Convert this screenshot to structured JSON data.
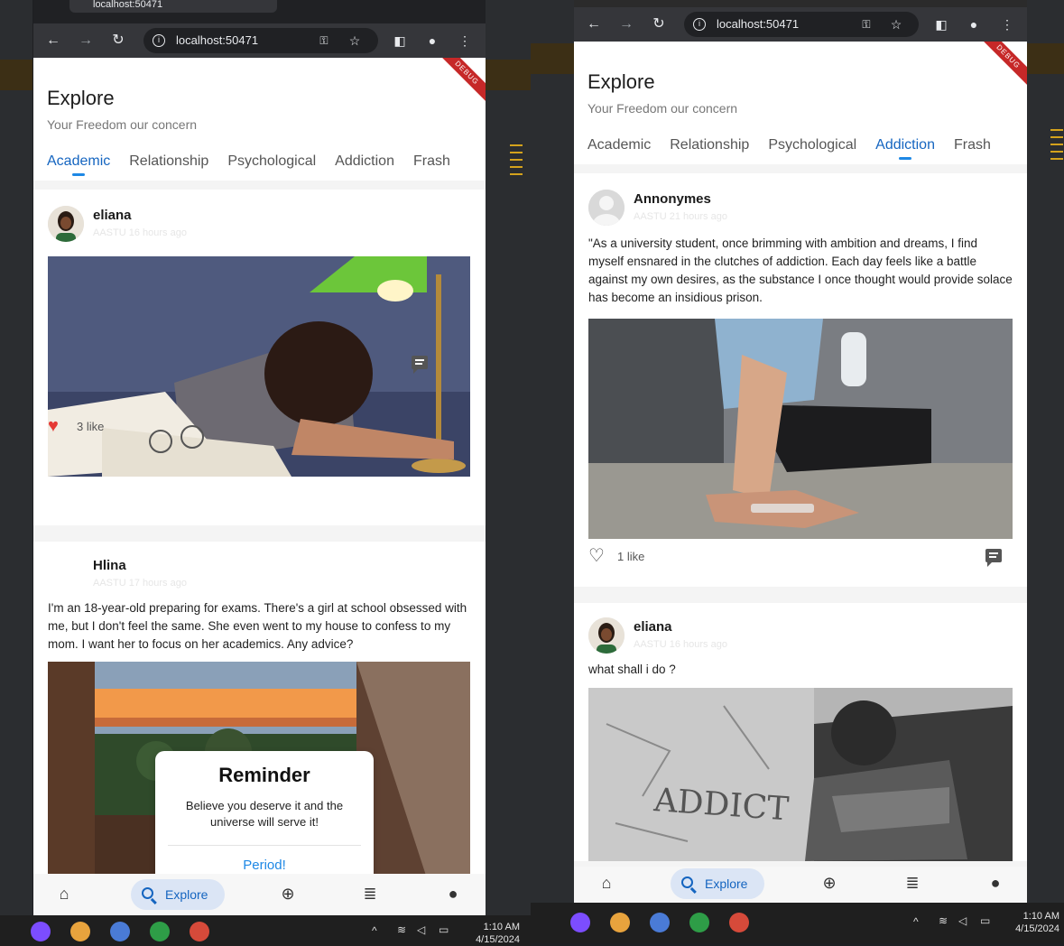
{
  "colors": {
    "accent": "#1565c0",
    "heart": "#e53935",
    "debug_banner": "#c62828"
  },
  "left_window": {
    "tab_title": "localhost:50471",
    "url": "localhost:50471",
    "app": {
      "title": "Explore",
      "subtitle": "Your Freedom our concern",
      "debug": "DEBUG",
      "tabs": [
        "Academic",
        "Relationship",
        "Psychological",
        "Addiction",
        "Frash"
      ],
      "active_tab": "Academic",
      "posts": [
        {
          "user": "eliana",
          "meta": "AASTU 16 hours ago",
          "image": "student-asleep-on-books-photo",
          "likes": "3 like",
          "liked": true
        },
        {
          "user": "Hlina",
          "meta": "AASTU 17 hours ago",
          "text": "I'm an 18-year-old preparing for exams. There's a girl at school obsessed with me, but I don't feel the same. She even went to my house to confess to my mom. I want her to focus on her academics. Any advice?",
          "image": "window-sunset-view-photo"
        }
      ],
      "reminder": {
        "title": "Reminder",
        "message": "Believe you deserve it and the universe will serve it!",
        "button": "Period!"
      },
      "bottom_nav": {
        "active_label": "Explore",
        "items": [
          "home-icon",
          "explore",
          "add-circle-icon",
          "list-icon",
          "person-icon"
        ]
      }
    },
    "taskbar": {
      "time": "1:10 AM",
      "date": "4/15/2024"
    }
  },
  "right_window": {
    "url": "localhost:50471",
    "app": {
      "title": "Explore",
      "subtitle": "Your Freedom our concern",
      "debug": "DEBUG",
      "tabs": [
        "Academic",
        "Relationship",
        "Psychological",
        "Addiction",
        "Frash"
      ],
      "active_tab": "Addiction",
      "posts": [
        {
          "user": "Annonymes",
          "meta": "AASTU 21 hours ago",
          "text": "\"As a university student, once brimming with ambition and dreams, I find myself ensnared in the clutches of addiction. Each day feels like a battle against my own desires, as the substance I once thought would provide solace has become an insidious prison.",
          "image": "person-with-pills-photo",
          "likes": "1 like",
          "liked": false
        },
        {
          "user": "eliana",
          "meta": "AASTU 16 hours ago",
          "text": "what shall i do ?",
          "image": "addict-wall-photo",
          "wall_text": "ADDICT"
        }
      ],
      "bottom_nav": {
        "active_label": "Explore",
        "items": [
          "home-icon",
          "explore",
          "add-circle-icon",
          "list-icon",
          "person-icon"
        ]
      }
    },
    "taskbar": {
      "time": "1:10 AM",
      "date": "4/15/2024"
    }
  }
}
